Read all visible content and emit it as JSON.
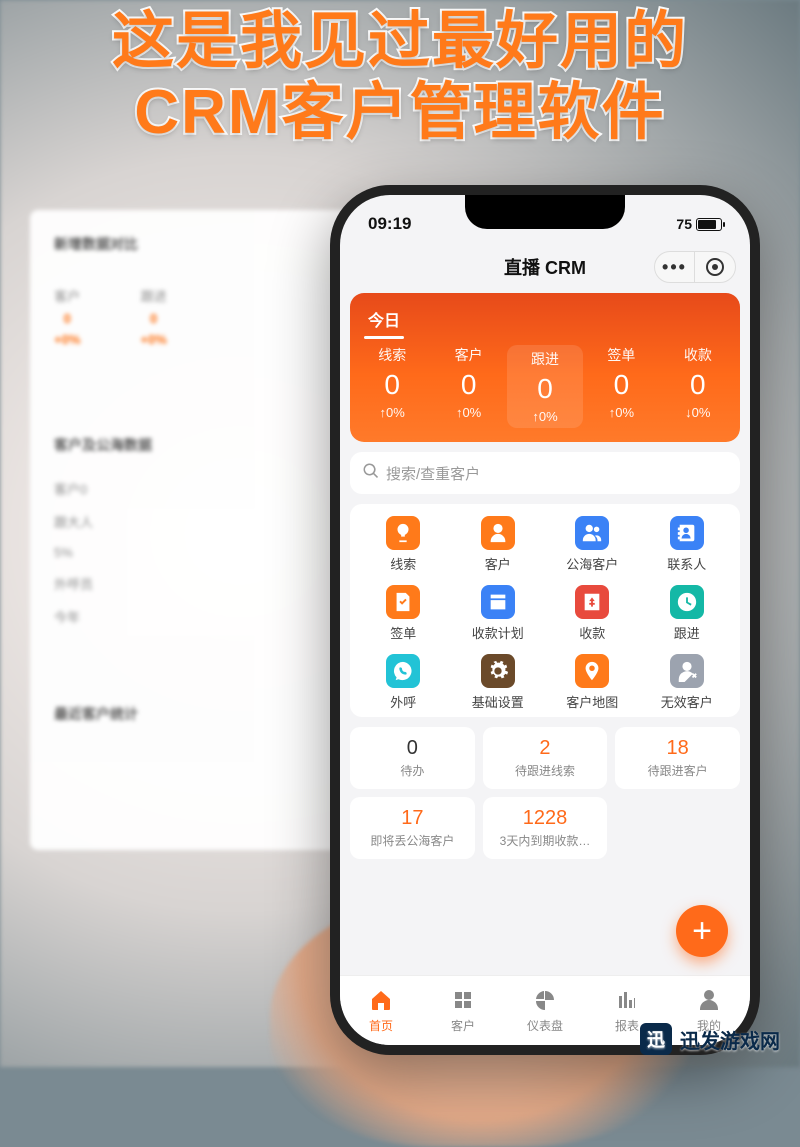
{
  "caption_line1": "这是我见过最好用的",
  "caption_line2": "CRM客户管理软件",
  "monitor": {
    "section1": "新增数据对比",
    "cols": [
      {
        "label": "客户",
        "value": "0",
        "pct": "+0%"
      },
      {
        "label": "跟进",
        "value": "0",
        "pct": "+0%"
      }
    ],
    "section2": "客户及公海数据",
    "list": [
      "客户0",
      "跟大人",
      "5%",
      "外呼员",
      "今年"
    ],
    "section3": "最近客户统计"
  },
  "status": {
    "time": "09:19",
    "battery": "75"
  },
  "app_title": "直播 CRM",
  "dash": {
    "tab": "今日",
    "cols": [
      {
        "label": "线索",
        "value": "0",
        "pct": "↑0%"
      },
      {
        "label": "客户",
        "value": "0",
        "pct": "↑0%"
      },
      {
        "label": "跟进",
        "value": "0",
        "pct": "↑0%"
      },
      {
        "label": "签单",
        "value": "0",
        "pct": "↑0%"
      },
      {
        "label": "收款",
        "value": "0",
        "pct": "↓0%"
      }
    ]
  },
  "search_placeholder": "搜索/查重客户",
  "modules": [
    {
      "name": "线索",
      "color": "ico-orange",
      "glyph": "lead"
    },
    {
      "name": "客户",
      "color": "ico-orange",
      "glyph": "person"
    },
    {
      "name": "公海客户",
      "color": "ico-blue",
      "glyph": "pool"
    },
    {
      "name": "联系人",
      "color": "ico-blue",
      "glyph": "contact"
    },
    {
      "name": "签单",
      "color": "ico-orange",
      "glyph": "sign"
    },
    {
      "name": "收款计划",
      "color": "ico-blue",
      "glyph": "plan"
    },
    {
      "name": "收款",
      "color": "ico-red",
      "glyph": "money"
    },
    {
      "name": "跟进",
      "color": "ico-teal",
      "glyph": "follow"
    },
    {
      "name": "外呼",
      "color": "ico-cyan",
      "glyph": "call"
    },
    {
      "name": "基础设置",
      "color": "ico-dark",
      "glyph": "gear"
    },
    {
      "name": "客户地图",
      "color": "ico-orange",
      "glyph": "pin"
    },
    {
      "name": "无效客户",
      "color": "ico-gray",
      "glyph": "invalid"
    }
  ],
  "tiles1": [
    {
      "n": "0",
      "label": "待办",
      "orange": false
    },
    {
      "n": "2",
      "label": "待跟进线索",
      "orange": true
    },
    {
      "n": "18",
      "label": "待跟进客户",
      "orange": true
    }
  ],
  "tiles2": [
    {
      "n": "17",
      "label": "即将丢公海客户",
      "orange": true
    },
    {
      "n": "1228",
      "label": "3天内到期收款…",
      "orange": true
    },
    {
      "n": "",
      "label": "",
      "orange": false
    }
  ],
  "tabbar": [
    {
      "label": "首页",
      "active": true
    },
    {
      "label": "客户",
      "active": false
    },
    {
      "label": "仪表盘",
      "active": false
    },
    {
      "label": "报表",
      "active": false
    },
    {
      "label": "我的",
      "active": false
    }
  ],
  "brand": "迅发游戏网"
}
